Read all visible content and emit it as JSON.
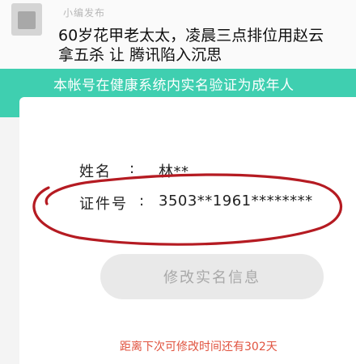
{
  "post": {
    "poster_name": "小编发布",
    "headline": "60岁花甲老太太，凌晨三点排位用赵云拿五杀 让 腾讯陷入沉思"
  },
  "banner": {
    "text": "本帐号在健康系统内实名验证为成年人"
  },
  "identity": {
    "name_label": "姓名",
    "name_colon": ":",
    "name_value": "林**",
    "id_label": "证件号",
    "id_colon": ":",
    "id_value": "3503**1961********"
  },
  "actions": {
    "modify_label": "修改实名信息"
  },
  "footer": {
    "countdown_text": "距离下次可修改时间还有302天"
  },
  "colors": {
    "banner": "#3fcfb0",
    "annotation_circle": "#b51b22",
    "countdown": "#e0533f"
  },
  "icons": {
    "avatar": "user-avatar"
  }
}
